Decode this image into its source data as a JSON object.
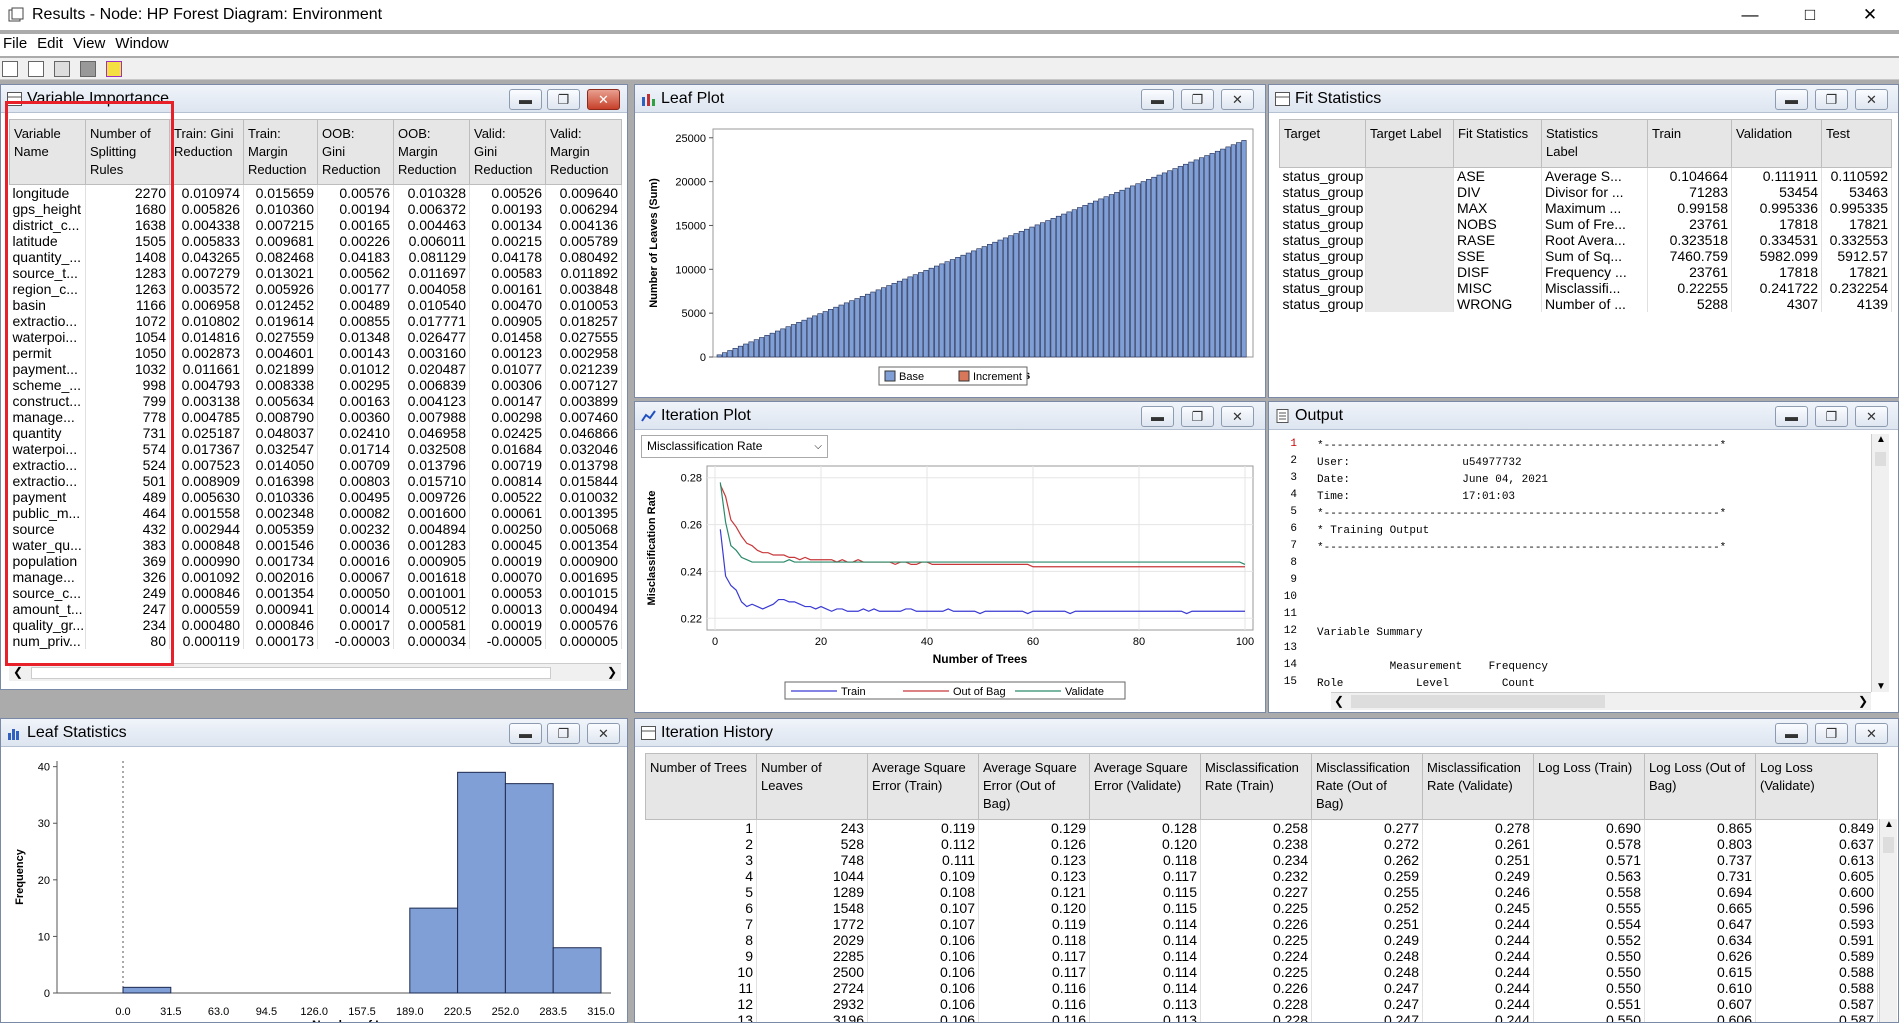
{
  "window": {
    "title": "Results - Node: HP Forest  Diagram: Environment"
  },
  "menu": [
    "File",
    "Edit",
    "View",
    "Window"
  ],
  "toolbar_icons": [
    "new-doc-icon",
    "properties-icon",
    "print-icon",
    "grid-icon",
    "highlight-icon"
  ],
  "var_importance": {
    "title": "Variable Importance",
    "headers": [
      "Variable\nName",
      "Number of\nSplitting\nRules",
      "Train: Gini\nReduction",
      "Train:\nMargin\nReduction",
      "OOB:\nGini\nReduction",
      "OOB:\nMargin\nReduction",
      "Valid:\nGini\nReduction",
      "Valid:\nMargin\nReduction"
    ],
    "rows": [
      [
        "longitude",
        "2270",
        "0.010974",
        "0.015659",
        "0.00576",
        "0.010328",
        "0.00526",
        "0.009640"
      ],
      [
        "gps_height",
        "1680",
        "0.005826",
        "0.010360",
        "0.00194",
        "0.006372",
        "0.00193",
        "0.006294"
      ],
      [
        "district_c...",
        "1638",
        "0.004338",
        "0.007215",
        "0.00165",
        "0.004463",
        "0.00134",
        "0.004136"
      ],
      [
        "latitude",
        "1505",
        "0.005833",
        "0.009681",
        "0.00226",
        "0.006011",
        "0.00215",
        "0.005789"
      ],
      [
        "quantity_...",
        "1408",
        "0.043265",
        "0.082468",
        "0.04183",
        "0.081129",
        "0.04178",
        "0.080492"
      ],
      [
        "source_t...",
        "1283",
        "0.007279",
        "0.013021",
        "0.00562",
        "0.011697",
        "0.00583",
        "0.011892"
      ],
      [
        "region_c...",
        "1263",
        "0.003572",
        "0.005926",
        "0.00177",
        "0.004058",
        "0.00161",
        "0.003848"
      ],
      [
        "basin",
        "1166",
        "0.006958",
        "0.012452",
        "0.00489",
        "0.010540",
        "0.00470",
        "0.010053"
      ],
      [
        "extractio...",
        "1072",
        "0.010802",
        "0.019614",
        "0.00855",
        "0.017771",
        "0.00905",
        "0.018257"
      ],
      [
        "waterpoi...",
        "1054",
        "0.014816",
        "0.027559",
        "0.01348",
        "0.026477",
        "0.01458",
        "0.027555"
      ],
      [
        "permit",
        "1050",
        "0.002873",
        "0.004601",
        "0.00143",
        "0.003160",
        "0.00123",
        "0.002958"
      ],
      [
        "payment...",
        "1032",
        "0.011661",
        "0.021899",
        "0.01012",
        "0.020487",
        "0.01077",
        "0.021239"
      ],
      [
        "scheme_...",
        "998",
        "0.004793",
        "0.008338",
        "0.00295",
        "0.006839",
        "0.00306",
        "0.007127"
      ],
      [
        "construct...",
        "799",
        "0.003138",
        "0.005634",
        "0.00163",
        "0.004123",
        "0.00147",
        "0.003899"
      ],
      [
        "manage...",
        "778",
        "0.004785",
        "0.008790",
        "0.00360",
        "0.007988",
        "0.00298",
        "0.007460"
      ],
      [
        "quantity",
        "731",
        "0.025187",
        "0.048037",
        "0.02410",
        "0.046958",
        "0.02425",
        "0.046866"
      ],
      [
        "waterpoi...",
        "574",
        "0.017367",
        "0.032547",
        "0.01714",
        "0.032508",
        "0.01684",
        "0.032046"
      ],
      [
        "extractio...",
        "524",
        "0.007523",
        "0.014050",
        "0.00709",
        "0.013796",
        "0.00719",
        "0.013798"
      ],
      [
        "extractio...",
        "501",
        "0.008909",
        "0.016398",
        "0.00803",
        "0.015710",
        "0.00814",
        "0.015844"
      ],
      [
        "payment",
        "489",
        "0.005630",
        "0.010336",
        "0.00495",
        "0.009726",
        "0.00522",
        "0.010032"
      ],
      [
        "public_m...",
        "464",
        "0.001558",
        "0.002348",
        "0.00082",
        "0.001600",
        "0.00061",
        "0.001395"
      ],
      [
        "source",
        "432",
        "0.002944",
        "0.005359",
        "0.00232",
        "0.004894",
        "0.00250",
        "0.005068"
      ],
      [
        "water_qu...",
        "383",
        "0.000848",
        "0.001546",
        "0.00036",
        "0.001283",
        "0.00045",
        "0.001354"
      ],
      [
        "population",
        "369",
        "0.000990",
        "0.001734",
        "0.00016",
        "0.000905",
        "0.00019",
        "0.000900"
      ],
      [
        "manage...",
        "326",
        "0.001092",
        "0.002016",
        "0.00067",
        "0.001618",
        "0.00070",
        "0.001695"
      ],
      [
        "source_c...",
        "249",
        "0.000846",
        "0.001354",
        "0.00050",
        "0.001001",
        "0.00053",
        "0.001015"
      ],
      [
        "amount_t...",
        "247",
        "0.000559",
        "0.000941",
        "0.00014",
        "0.000512",
        "0.00013",
        "0.000494"
      ],
      [
        "quality_gr...",
        "234",
        "0.000480",
        "0.000846",
        "0.00017",
        "0.000581",
        "0.00019",
        "0.000576"
      ],
      [
        "num_priv...",
        "80",
        "0.000119",
        "0.000173",
        "-0.00003",
        "0.000034",
        "-0.00005",
        "0.000005"
      ]
    ]
  },
  "leaf_plot": {
    "title": "Leaf Plot",
    "chart_data": {
      "type": "bar",
      "xlabel": "Number of Trees",
      "ylabel": "Number of Leaves (Sum)",
      "yticks": [
        "0",
        "5000",
        "10000",
        "15000",
        "20000",
        "25000"
      ],
      "ylim": [
        0,
        26000
      ],
      "series": [
        {
          "name": "Base",
          "color": "#7f9fd6"
        },
        {
          "name": "Increment",
          "color": "#d9775a"
        }
      ],
      "n_bars": 100,
      "last_value": 24700
    }
  },
  "fit_stats": {
    "title": "Fit Statistics",
    "headers": [
      "Target",
      "Target Label",
      "Fit Statistics",
      "Statistics\nLabel",
      "Train",
      "Validation",
      "Test"
    ],
    "rows": [
      [
        "status_group",
        "",
        "ASE",
        "Average S...",
        "0.104664",
        "0.111911",
        "0.110592"
      ],
      [
        "status_group",
        "",
        "DIV",
        "Divisor for ...",
        "71283",
        "53454",
        "53463"
      ],
      [
        "status_group",
        "",
        "MAX",
        "Maximum ...",
        "0.99158",
        "0.995336",
        "0.995335"
      ],
      [
        "status_group",
        "",
        "NOBS",
        "Sum of Fre...",
        "23761",
        "17818",
        "17821"
      ],
      [
        "status_group",
        "",
        "RASE",
        "Root Avera...",
        "0.323518",
        "0.334531",
        "0.332553"
      ],
      [
        "status_group",
        "",
        "SSE",
        "Sum of Sq...",
        "7460.759",
        "5982.099",
        "5912.57"
      ],
      [
        "status_group",
        "",
        "DISF",
        "Frequency ...",
        "23761",
        "17818",
        "17821"
      ],
      [
        "status_group",
        "",
        "MISC",
        "Misclassifi...",
        "0.22255",
        "0.241722",
        "0.232254"
      ],
      [
        "status_group",
        "",
        "WRONG",
        "Number of ...",
        "5288",
        "4307",
        "4139"
      ]
    ]
  },
  "iteration_plot": {
    "title": "Iteration Plot",
    "dropdown": "Misclassification Rate",
    "chart_data": {
      "type": "line",
      "xlabel": "Number of Trees",
      "ylabel": "Misclassification Rate",
      "xticks": [
        "0",
        "20",
        "40",
        "60",
        "80",
        "100"
      ],
      "yticks": [
        "0.22",
        "0.24",
        "0.26",
        "0.28"
      ],
      "xlim": [
        0,
        100
      ],
      "ylim": [
        0.215,
        0.285
      ],
      "series": [
        {
          "name": "Train",
          "color": "#3a3ad4",
          "values": [
            0.258,
            0.238,
            0.234,
            0.232,
            0.227,
            0.225,
            0.226,
            0.225,
            0.224,
            0.225,
            0.226,
            0.228,
            0.228,
            0.227,
            0.227,
            0.226,
            0.225,
            0.225,
            0.224,
            0.225,
            0.224,
            0.223,
            0.224,
            0.224,
            0.223,
            0.223,
            0.223,
            0.224,
            0.223,
            0.224,
            0.223,
            0.223,
            0.223,
            0.223,
            0.223,
            0.224,
            0.224,
            0.223,
            0.223,
            0.223,
            0.223,
            0.223,
            0.223,
            0.224,
            0.223,
            0.223,
            0.223,
            0.223,
            0.223,
            0.222,
            0.223,
            0.223,
            0.223,
            0.223,
            0.223,
            0.223,
            0.223,
            0.223,
            0.222,
            0.223,
            0.223,
            0.223,
            0.223,
            0.223,
            0.223,
            0.223,
            0.222,
            0.223,
            0.223,
            0.223,
            0.223,
            0.223,
            0.223,
            0.223,
            0.223,
            0.223,
            0.223,
            0.223,
            0.223,
            0.223,
            0.223,
            0.223,
            0.223,
            0.223,
            0.223,
            0.223,
            0.223,
            0.223,
            0.222,
            0.223,
            0.223,
            0.223,
            0.223,
            0.223,
            0.223,
            0.223,
            0.223,
            0.223,
            0.223,
            0.223
          ]
        },
        {
          "name": "Out of Bag",
          "color": "#c8383a",
          "values": [
            0.277,
            0.272,
            0.262,
            0.259,
            0.255,
            0.252,
            0.251,
            0.249,
            0.248,
            0.248,
            0.247,
            0.247,
            0.247,
            0.246,
            0.246,
            0.245,
            0.246,
            0.245,
            0.245,
            0.245,
            0.245,
            0.245,
            0.244,
            0.245,
            0.244,
            0.244,
            0.245,
            0.244,
            0.244,
            0.244,
            0.244,
            0.244,
            0.244,
            0.243,
            0.244,
            0.244,
            0.243,
            0.243,
            0.244,
            0.244,
            0.243,
            0.243,
            0.243,
            0.243,
            0.243,
            0.243,
            0.243,
            0.243,
            0.243,
            0.243,
            0.243,
            0.243,
            0.243,
            0.243,
            0.243,
            0.243,
            0.243,
            0.243,
            0.243,
            0.242,
            0.242,
            0.242,
            0.242,
            0.242,
            0.242,
            0.242,
            0.242,
            0.242,
            0.242,
            0.242,
            0.242,
            0.242,
            0.242,
            0.242,
            0.242,
            0.242,
            0.242,
            0.242,
            0.242,
            0.242,
            0.242,
            0.242,
            0.242,
            0.242,
            0.242,
            0.242,
            0.242,
            0.242,
            0.242,
            0.242,
            0.242,
            0.242,
            0.242,
            0.242,
            0.242,
            0.242,
            0.242,
            0.242,
            0.242,
            0.242
          ]
        },
        {
          "name": "Validate",
          "color": "#2a8a6a",
          "values": [
            0.278,
            0.261,
            0.251,
            0.249,
            0.246,
            0.245,
            0.244,
            0.244,
            0.244,
            0.244,
            0.244,
            0.244,
            0.244,
            0.245,
            0.244,
            0.244,
            0.244,
            0.244,
            0.244,
            0.244,
            0.244,
            0.244,
            0.244,
            0.244,
            0.244,
            0.244,
            0.244,
            0.244,
            0.244,
            0.244,
            0.244,
            0.244,
            0.244,
            0.244,
            0.244,
            0.244,
            0.244,
            0.244,
            0.244,
            0.244,
            0.244,
            0.244,
            0.244,
            0.244,
            0.244,
            0.244,
            0.244,
            0.244,
            0.244,
            0.244,
            0.244,
            0.244,
            0.244,
            0.244,
            0.244,
            0.244,
            0.244,
            0.244,
            0.244,
            0.244,
            0.244,
            0.244,
            0.244,
            0.244,
            0.244,
            0.244,
            0.244,
            0.244,
            0.244,
            0.244,
            0.244,
            0.244,
            0.244,
            0.244,
            0.244,
            0.244,
            0.244,
            0.244,
            0.244,
            0.244,
            0.244,
            0.244,
            0.244,
            0.244,
            0.244,
            0.244,
            0.244,
            0.244,
            0.244,
            0.244,
            0.244,
            0.244,
            0.244,
            0.244,
            0.244,
            0.244,
            0.244,
            0.244,
            0.244,
            0.243
          ]
        }
      ]
    }
  },
  "output": {
    "title": "Output",
    "line_numbers": [
      "1",
      "2",
      "3",
      "4",
      "5",
      "6",
      "7",
      "8",
      "9",
      "10",
      "11",
      "12",
      "13",
      "14",
      "15"
    ],
    "lines": [
      "*------------------------------------------------------------*",
      "User:                 u54977732",
      "Date:                 June 04, 2021",
      "Time:                 17:01:03",
      "*------------------------------------------------------------*",
      "* Training Output",
      "*------------------------------------------------------------*",
      "",
      "",
      "",
      "",
      "Variable Summary",
      "",
      "           Measurement    Frequency",
      "Role           Level        Count"
    ]
  },
  "leaf_stats": {
    "title": "Leaf Statistics",
    "chart_data": {
      "type": "bar",
      "xlabel": "Number of Leaves",
      "ylabel": "Frequency",
      "xticks": [
        "0.0",
        "31.5",
        "63.0",
        "94.5",
        "126.0",
        "157.5",
        "189.0",
        "220.5",
        "252.0",
        "283.5",
        "315.0"
      ],
      "yticks": [
        "0",
        "10",
        "20",
        "30",
        "40"
      ],
      "ylim": [
        0,
        41
      ],
      "bins": [
        [
          0.0,
          31.5,
          1
        ],
        [
          189.0,
          220.5,
          15
        ],
        [
          220.5,
          252.0,
          39
        ],
        [
          252.0,
          283.5,
          37
        ],
        [
          283.5,
          315.0,
          8
        ]
      ]
    }
  },
  "iter_history": {
    "title": "Iteration History",
    "headers": [
      "Number of Trees",
      "Number of\nLeaves",
      "Average Square\nError (Train)",
      "Average Square\nError (Out of\nBag)",
      "Average Square\nError (Validate)",
      "Misclassification\nRate (Train)",
      "Misclassification\nRate (Out of\nBag)",
      "Misclassification\nRate (Validate)",
      "Log Loss (Train)",
      "Log Loss (Out of\nBag)",
      "Log Loss\n(Validate)"
    ],
    "rows": [
      [
        "1",
        "243",
        "0.119",
        "0.129",
        "0.128",
        "0.258",
        "0.277",
        "0.278",
        "0.690",
        "0.865",
        "0.849"
      ],
      [
        "2",
        "528",
        "0.112",
        "0.126",
        "0.120",
        "0.238",
        "0.272",
        "0.261",
        "0.578",
        "0.803",
        "0.637"
      ],
      [
        "3",
        "748",
        "0.111",
        "0.123",
        "0.118",
        "0.234",
        "0.262",
        "0.251",
        "0.571",
        "0.737",
        "0.613"
      ],
      [
        "4",
        "1044",
        "0.109",
        "0.123",
        "0.117",
        "0.232",
        "0.259",
        "0.249",
        "0.563",
        "0.731",
        "0.605"
      ],
      [
        "5",
        "1289",
        "0.108",
        "0.121",
        "0.115",
        "0.227",
        "0.255",
        "0.246",
        "0.558",
        "0.694",
        "0.600"
      ],
      [
        "6",
        "1548",
        "0.107",
        "0.120",
        "0.115",
        "0.225",
        "0.252",
        "0.245",
        "0.555",
        "0.665",
        "0.596"
      ],
      [
        "7",
        "1772",
        "0.107",
        "0.119",
        "0.114",
        "0.226",
        "0.251",
        "0.244",
        "0.554",
        "0.647",
        "0.593"
      ],
      [
        "8",
        "2029",
        "0.106",
        "0.118",
        "0.114",
        "0.225",
        "0.249",
        "0.244",
        "0.552",
        "0.634",
        "0.591"
      ],
      [
        "9",
        "2285",
        "0.106",
        "0.117",
        "0.114",
        "0.224",
        "0.248",
        "0.244",
        "0.550",
        "0.626",
        "0.589"
      ],
      [
        "10",
        "2500",
        "0.106",
        "0.117",
        "0.114",
        "0.225",
        "0.248",
        "0.244",
        "0.550",
        "0.615",
        "0.588"
      ],
      [
        "11",
        "2724",
        "0.106",
        "0.116",
        "0.114",
        "0.226",
        "0.247",
        "0.244",
        "0.550",
        "0.610",
        "0.588"
      ],
      [
        "12",
        "2932",
        "0.106",
        "0.116",
        "0.113",
        "0.228",
        "0.247",
        "0.244",
        "0.551",
        "0.607",
        "0.587"
      ],
      [
        "13",
        "3196",
        "0.106",
        "0.116",
        "0.113",
        "0.228",
        "0.247",
        "0.244",
        "0.550",
        "0.606",
        "0.587"
      ]
    ]
  }
}
